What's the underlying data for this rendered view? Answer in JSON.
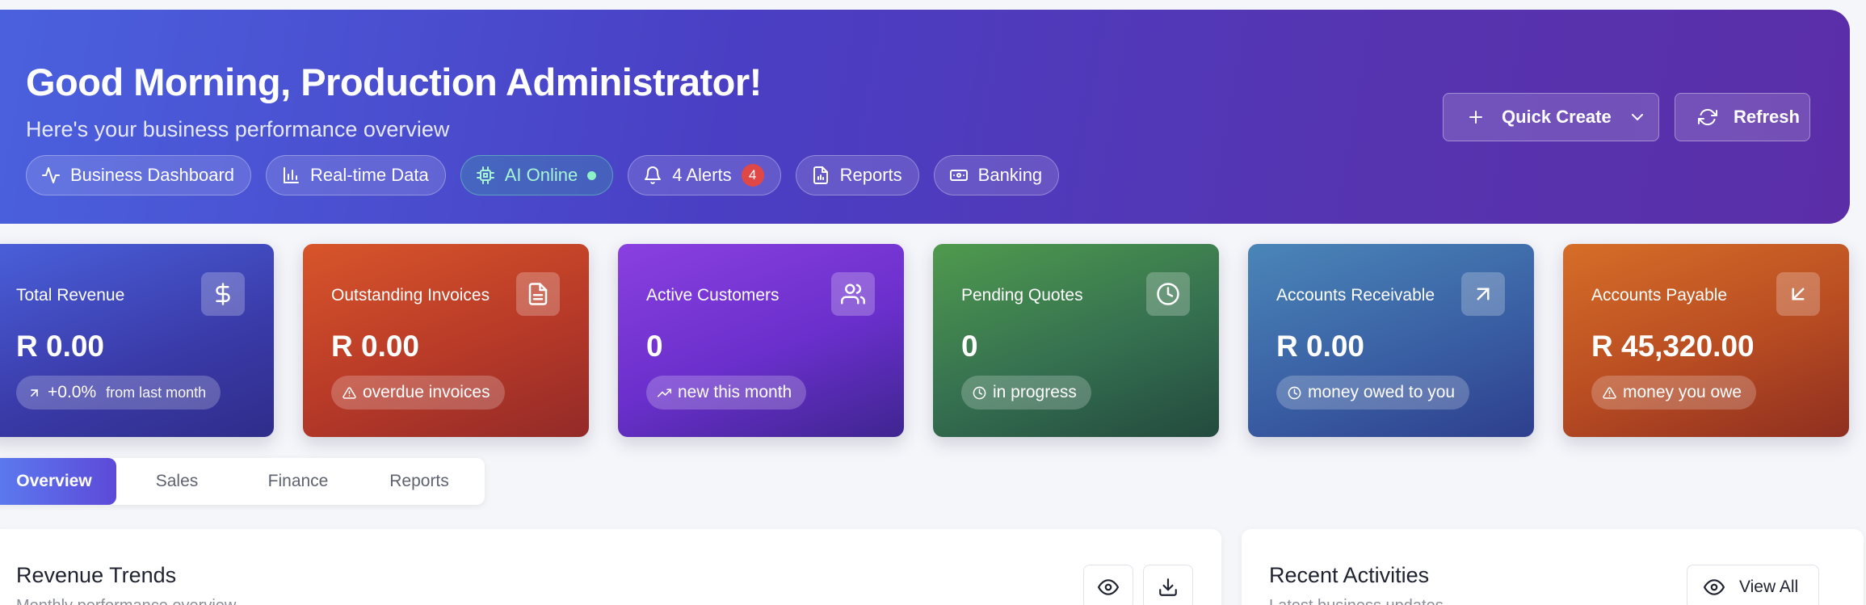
{
  "hero": {
    "title": "Good Morning, Production Administrator!",
    "subtitle": "Here's your business performance overview",
    "pills": [
      {
        "label": "Business Dashboard",
        "icon": "activity-icon"
      },
      {
        "label": "Real-time Data",
        "icon": "bar-chart-icon"
      },
      {
        "label": "AI Online",
        "icon": "cpu-icon"
      },
      {
        "label": "4 Alerts",
        "icon": "bell-icon",
        "count": "4"
      },
      {
        "label": "Reports",
        "icon": "file-icon"
      },
      {
        "label": "Banking",
        "icon": "banknote-icon"
      }
    ],
    "quick_create_label": "Quick Create",
    "refresh_label": "Refresh"
  },
  "cards": [
    {
      "label": "Total Revenue",
      "value": "R 0.00",
      "badge": "+0.0%",
      "badge_note": "from last month",
      "icon": "dollar-icon"
    },
    {
      "label": "Outstanding Invoices",
      "value": "R 0.00",
      "badge": "overdue invoices",
      "icon": "file-text-icon"
    },
    {
      "label": "Active Customers",
      "value": "0",
      "badge": "new this month",
      "icon": "users-icon"
    },
    {
      "label": "Pending Quotes",
      "value": "0",
      "badge": "in progress",
      "icon": "clock-icon"
    },
    {
      "label": "Accounts Receivable",
      "value": "R 0.00",
      "badge": "money owed to you",
      "icon": "arrow-up-right-icon"
    },
    {
      "label": "Accounts Payable",
      "value": "R 45,320.00",
      "badge": "money you owe",
      "icon": "arrow-down-left-icon"
    }
  ],
  "tabs": [
    {
      "label": "Overview",
      "active": true
    },
    {
      "label": "Sales"
    },
    {
      "label": "Finance"
    },
    {
      "label": "Reports"
    }
  ],
  "revenue_panel": {
    "title": "Revenue Trends",
    "subtitle": "Monthly performance overview"
  },
  "activities_panel": {
    "title": "Recent Activities",
    "subtitle": "Latest business updates",
    "view_all_label": "View All"
  },
  "colors": {
    "hero_start": "#4a62de",
    "hero_end": "#5b2ea8",
    "tab_active": "#5b7cf0",
    "alert_badge": "#e04848",
    "ai_status": "#8ef2c7"
  }
}
